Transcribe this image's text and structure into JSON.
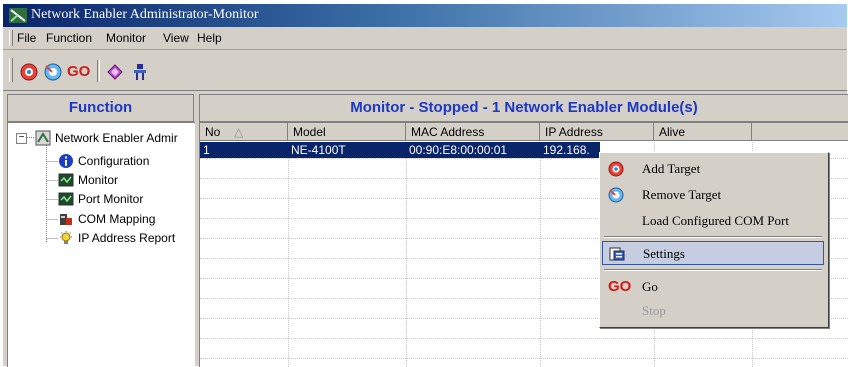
{
  "window": {
    "title": "Network Enabler Administrator-Monitor"
  },
  "menu": {
    "items": [
      "File",
      "Function",
      "Monitor",
      "View",
      "Help"
    ]
  },
  "toolbar": {
    "buttons": [
      {
        "name": "add-target",
        "icon": "add-target-icon"
      },
      {
        "name": "remove-target",
        "icon": "remove-target-icon"
      },
      {
        "name": "go",
        "label": "GO"
      },
      {
        "name": "settings",
        "icon": "settings-icon"
      },
      {
        "name": "properties",
        "icon": "properties-icon"
      }
    ]
  },
  "function_panel": {
    "title": "Function",
    "root": "Network Enabler Admir",
    "items": [
      {
        "label": "Configuration",
        "icon": "info-icon"
      },
      {
        "label": "Monitor",
        "icon": "monitor-icon"
      },
      {
        "label": "Port Monitor",
        "icon": "monitor-icon"
      },
      {
        "label": "COM Mapping",
        "icon": "com-mapping-icon"
      },
      {
        "label": "IP Address Report",
        "icon": "bulb-icon"
      }
    ]
  },
  "monitor_panel": {
    "title": "Monitor - Stopped - 1 Network Enabler Module(s)",
    "columns": [
      "No",
      "Model",
      "MAC Address",
      "IP Address",
      "Alive"
    ],
    "rows": [
      {
        "no": "1",
        "model": "NE-4100T",
        "mac": "00:90:E8:00:00:01",
        "ip": "192.168."
      }
    ]
  },
  "context_menu": {
    "items": [
      {
        "label": "Add Target",
        "icon": "add-target-icon",
        "enabled": true
      },
      {
        "label": "Remove Target",
        "icon": "remove-target-icon",
        "enabled": true
      },
      {
        "label": "Load Configured COM Port",
        "enabled": true
      },
      {
        "label": "Settings",
        "icon": "settings-icon",
        "enabled": true,
        "highlighted": true
      },
      {
        "label": "Go",
        "icon_text": "GO",
        "enabled": true
      },
      {
        "label": "Stop",
        "enabled": false
      }
    ]
  },
  "colors": {
    "accent": "#1d37c6",
    "selection": "#0a246a",
    "go": "#d11b1b"
  }
}
